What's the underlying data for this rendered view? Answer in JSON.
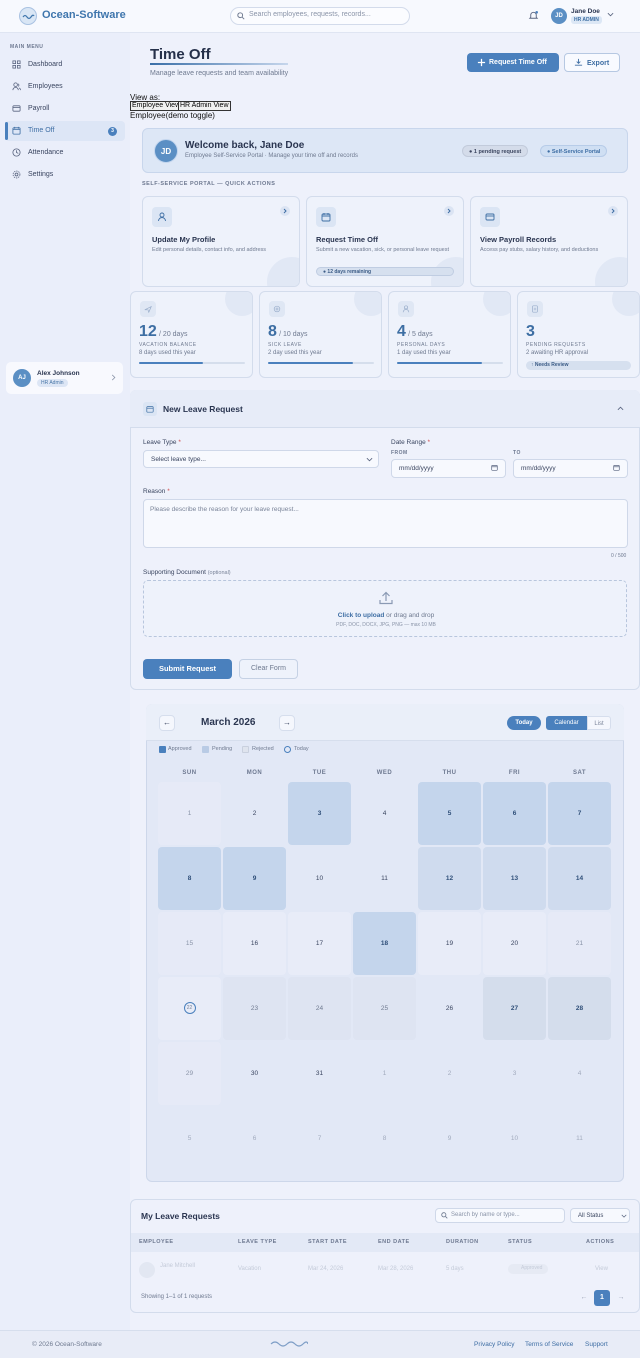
{
  "app": {
    "name": "Ocean-Software",
    "search_placeholder": "Search employees, requests, records...",
    "user": {
      "initials": "JD",
      "name": "Jane Doe",
      "role": "HR ADMIN"
    }
  },
  "sidebar": {
    "section_title": "MAIN MENU",
    "items": [
      {
        "label": "Dashboard",
        "icon": "grid-icon"
      },
      {
        "label": "Employees",
        "icon": "users-icon"
      },
      {
        "label": "Payroll",
        "icon": "wallet-icon"
      },
      {
        "label": "Time Off",
        "icon": "calendar-icon",
        "active": true,
        "badge": "3"
      },
      {
        "label": "Attendance",
        "icon": "clock-icon"
      },
      {
        "label": "Settings",
        "icon": "gear-icon"
      }
    ],
    "user_card": {
      "initials": "AJ",
      "name": "Alex Johnson",
      "role": "HR Admin"
    }
  },
  "page": {
    "title": "Time Off",
    "subtitle": "Manage leave requests and team availability",
    "request_button": "Request Time Off",
    "export_button": "Export"
  },
  "view_toggle": {
    "label": "View as:",
    "employee": "Employee View",
    "admin": "HR Admin View",
    "note": "Employee(demo toggle)"
  },
  "welcome": {
    "initials": "JD",
    "title": "Welcome back, Jane Doe",
    "subtitle": "Employee Self-Service Portal · Manage your time off and records",
    "pending_pill": "1 pending request",
    "portal_pill": "Self-Service Portal"
  },
  "quick_actions": {
    "label": "SELF-SERVICE PORTAL — QUICK ACTIONS",
    "items": [
      {
        "title": "Update My Profile",
        "desc": "Edit personal details, contact info, and address",
        "icon": "user-icon"
      },
      {
        "title": "Request Time Off",
        "desc": "Submit a new vacation, sick, or personal leave request",
        "icon": "calendar-icon",
        "badge": "12 days remaining"
      },
      {
        "title": "View Payroll Records",
        "desc": "Access pay stubs, salary history, and deductions",
        "icon": "credit-card-icon"
      }
    ]
  },
  "stats": [
    {
      "value": "12",
      "of": "/ 20 days",
      "label": "VACATION BALANCE",
      "sub": "8 days used this year",
      "progress": 0.6,
      "icon": "plane-icon"
    },
    {
      "value": "8",
      "of": "/ 10 days",
      "label": "SICK LEAVE",
      "sub": "2 day used this year",
      "progress": 0.8,
      "icon": "medical-icon"
    },
    {
      "value": "4",
      "of": "/ 5 days",
      "label": "PERSONAL DAYS",
      "sub": "1 day used this year",
      "progress": 0.8,
      "icon": "person-icon"
    },
    {
      "value": "3",
      "of": "",
      "label": "PENDING REQUESTS",
      "sub": "2 awaiting HR approval",
      "badge": "Needs Review",
      "icon": "document-icon"
    }
  ],
  "form": {
    "title": "New Leave Request",
    "leave_type_label": "Leave Type",
    "leave_type_placeholder": "Select leave type...",
    "date_range_label": "Date Range",
    "from_label": "FROM",
    "to_label": "TO",
    "date_placeholder": "mm/dd/yyyy",
    "reason_label": "Reason",
    "reason_placeholder": "Please describe the reason for your leave request...",
    "counter": "0 / 500",
    "doc_label": "Supporting Document",
    "doc_optional": "(optional)",
    "upload_link": "Click to upload",
    "upload_text": "or drag and drop",
    "upload_hint": "PDF, DOC, DOCX, JPG, PNG — max 10 MB",
    "submit": "Submit Request",
    "clear": "Clear Form"
  },
  "calendar": {
    "month": "March 2026",
    "prev": "←",
    "next": "→",
    "today": "Today",
    "view_calendar": "Calendar",
    "view_list": "List",
    "legend": [
      "Approved",
      "Pending",
      "Rejected",
      "Today"
    ],
    "weekdays": [
      "SUN",
      "MON",
      "TUE",
      "WED",
      "THU",
      "FRI",
      "SAT"
    ],
    "days": [
      {
        "d": "1",
        "s": "weekend"
      },
      {
        "d": "2",
        "s": "none"
      },
      {
        "d": "3",
        "s": "approved"
      },
      {
        "d": "4",
        "s": "none"
      },
      {
        "d": "5",
        "s": "approved"
      },
      {
        "d": "6",
        "s": "approved"
      },
      {
        "d": "7",
        "s": "approved"
      },
      {
        "d": "8",
        "s": "approved"
      },
      {
        "d": "9",
        "s": "approved"
      },
      {
        "d": "10",
        "s": "none"
      },
      {
        "d": "11",
        "s": "none"
      },
      {
        "d": "12",
        "s": "pending"
      },
      {
        "d": "13",
        "s": "pending"
      },
      {
        "d": "14",
        "s": "pending"
      },
      {
        "d": "15",
        "s": "weekend"
      },
      {
        "d": "16",
        "s": "plain"
      },
      {
        "d": "17",
        "s": "plain"
      },
      {
        "d": "18",
        "s": "approved"
      },
      {
        "d": "19",
        "s": "plain"
      },
      {
        "d": "20",
        "s": "plain"
      },
      {
        "d": "21",
        "s": "weekend"
      },
      {
        "d": "22",
        "s": "today"
      },
      {
        "d": "23",
        "s": "faded"
      },
      {
        "d": "24",
        "s": "faded"
      },
      {
        "d": "25",
        "s": "faded"
      },
      {
        "d": "26",
        "s": "none"
      },
      {
        "d": "27",
        "s": "fadedb"
      },
      {
        "d": "28",
        "s": "fadedb"
      },
      {
        "d": "29",
        "s": "weekend"
      },
      {
        "d": "30",
        "s": "none"
      },
      {
        "d": "31",
        "s": "none"
      },
      {
        "d": "1",
        "s": "other"
      },
      {
        "d": "2",
        "s": "other"
      },
      {
        "d": "3",
        "s": "other"
      },
      {
        "d": "4",
        "s": "other"
      },
      {
        "d": "5",
        "s": "other"
      },
      {
        "d": "6",
        "s": "other"
      },
      {
        "d": "7",
        "s": "other"
      },
      {
        "d": "8",
        "s": "other"
      },
      {
        "d": "9",
        "s": "other"
      },
      {
        "d": "10",
        "s": "other"
      },
      {
        "d": "11",
        "s": "other"
      }
    ]
  },
  "requests": {
    "title": "My Leave Requests",
    "search_placeholder": "Search by name or type...",
    "status_filter": "All Status",
    "columns": [
      "EMPLOYEE",
      "LEAVE TYPE",
      "START DATE",
      "END DATE",
      "DURATION",
      "STATUS",
      "ACTIONS"
    ],
    "row": {
      "employee": "Jane Mitchell",
      "leave_type": "Vacation",
      "start": "Mar 24, 2026",
      "end": "Mar 28, 2026",
      "duration": "5 days",
      "status": "Approved",
      "action": "View"
    },
    "showing": "Showing 1–1 of 1 requests",
    "page": "1",
    "prev": "←",
    "next": "→"
  },
  "footer": {
    "copyright": "© 2026 Ocean-Software",
    "links": [
      "Privacy Policy",
      "Terms of Service",
      "Support"
    ]
  },
  "colors": {
    "accent": "#4a80bd",
    "approved": "#c4d5ec",
    "pending": "#cfdbee",
    "rejected": "#dfe4ee"
  }
}
